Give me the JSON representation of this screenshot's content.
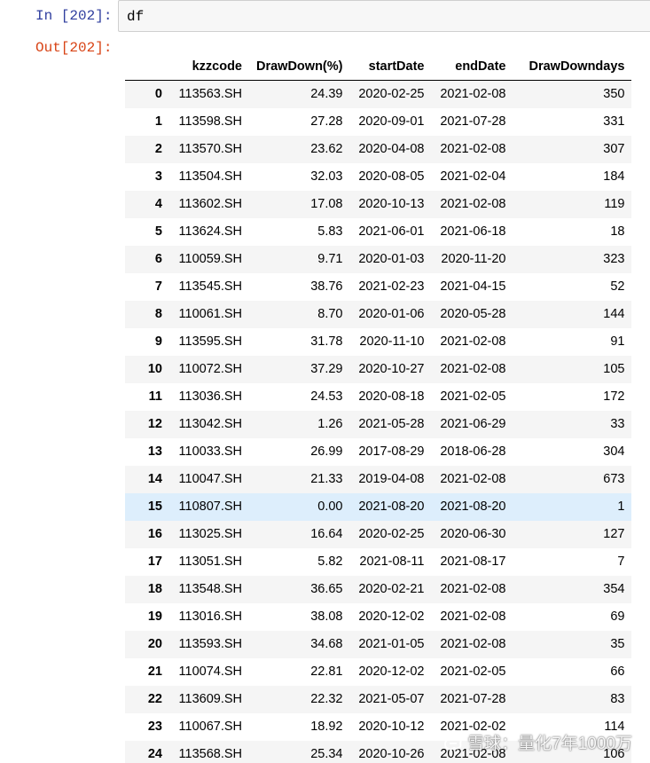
{
  "cell": {
    "in_prompt": "In [202]:",
    "code": "df",
    "out_prompt": "Out[202]:"
  },
  "table": {
    "columns": [
      "",
      "kzzcode",
      "DrawDown(%)",
      "startDate",
      "endDate",
      "DrawDowndays"
    ],
    "rows": [
      [
        "0",
        "113563.SH",
        "24.39",
        "2020-02-25",
        "2021-02-08",
        "350"
      ],
      [
        "1",
        "113598.SH",
        "27.28",
        "2020-09-01",
        "2021-07-28",
        "331"
      ],
      [
        "2",
        "113570.SH",
        "23.62",
        "2020-04-08",
        "2021-02-08",
        "307"
      ],
      [
        "3",
        "113504.SH",
        "32.03",
        "2020-08-05",
        "2021-02-04",
        "184"
      ],
      [
        "4",
        "113602.SH",
        "17.08",
        "2020-10-13",
        "2021-02-08",
        "119"
      ],
      [
        "5",
        "113624.SH",
        "5.83",
        "2021-06-01",
        "2021-06-18",
        "18"
      ],
      [
        "6",
        "110059.SH",
        "9.71",
        "2020-01-03",
        "2020-11-20",
        "323"
      ],
      [
        "7",
        "113545.SH",
        "38.76",
        "2021-02-23",
        "2021-04-15",
        "52"
      ],
      [
        "8",
        "110061.SH",
        "8.70",
        "2020-01-06",
        "2020-05-28",
        "144"
      ],
      [
        "9",
        "113595.SH",
        "31.78",
        "2020-11-10",
        "2021-02-08",
        "91"
      ],
      [
        "10",
        "110072.SH",
        "37.29",
        "2020-10-27",
        "2021-02-08",
        "105"
      ],
      [
        "11",
        "113036.SH",
        "24.53",
        "2020-08-18",
        "2021-02-05",
        "172"
      ],
      [
        "12",
        "113042.SH",
        "1.26",
        "2021-05-28",
        "2021-06-29",
        "33"
      ],
      [
        "13",
        "110033.SH",
        "26.99",
        "2017-08-29",
        "2018-06-28",
        "304"
      ],
      [
        "14",
        "110047.SH",
        "21.33",
        "2019-04-08",
        "2021-02-08",
        "673"
      ],
      [
        "15",
        "110807.SH",
        "0.00",
        "2021-08-20",
        "2021-08-20",
        "1"
      ],
      [
        "16",
        "113025.SH",
        "16.64",
        "2020-02-25",
        "2020-06-30",
        "127"
      ],
      [
        "17",
        "113051.SH",
        "5.82",
        "2021-08-11",
        "2021-08-17",
        "7"
      ],
      [
        "18",
        "113548.SH",
        "36.65",
        "2020-02-21",
        "2021-02-08",
        "354"
      ],
      [
        "19",
        "113016.SH",
        "38.08",
        "2020-12-02",
        "2021-02-08",
        "69"
      ],
      [
        "20",
        "113593.SH",
        "34.68",
        "2021-01-05",
        "2021-02-08",
        "35"
      ],
      [
        "21",
        "110074.SH",
        "22.81",
        "2020-12-02",
        "2021-02-05",
        "66"
      ],
      [
        "22",
        "113609.SH",
        "22.32",
        "2021-05-07",
        "2021-07-28",
        "83"
      ],
      [
        "23",
        "110067.SH",
        "18.92",
        "2020-10-12",
        "2021-02-02",
        "114"
      ],
      [
        "24",
        "113568.SH",
        "25.34",
        "2020-10-26",
        "2021-02-08",
        "106"
      ]
    ],
    "highlighted_row": 15,
    "highlight_color": "#ddeefc"
  },
  "watermark": {
    "icon": "snowball-logo-icon",
    "text": "雪球：量化7年1000万"
  }
}
